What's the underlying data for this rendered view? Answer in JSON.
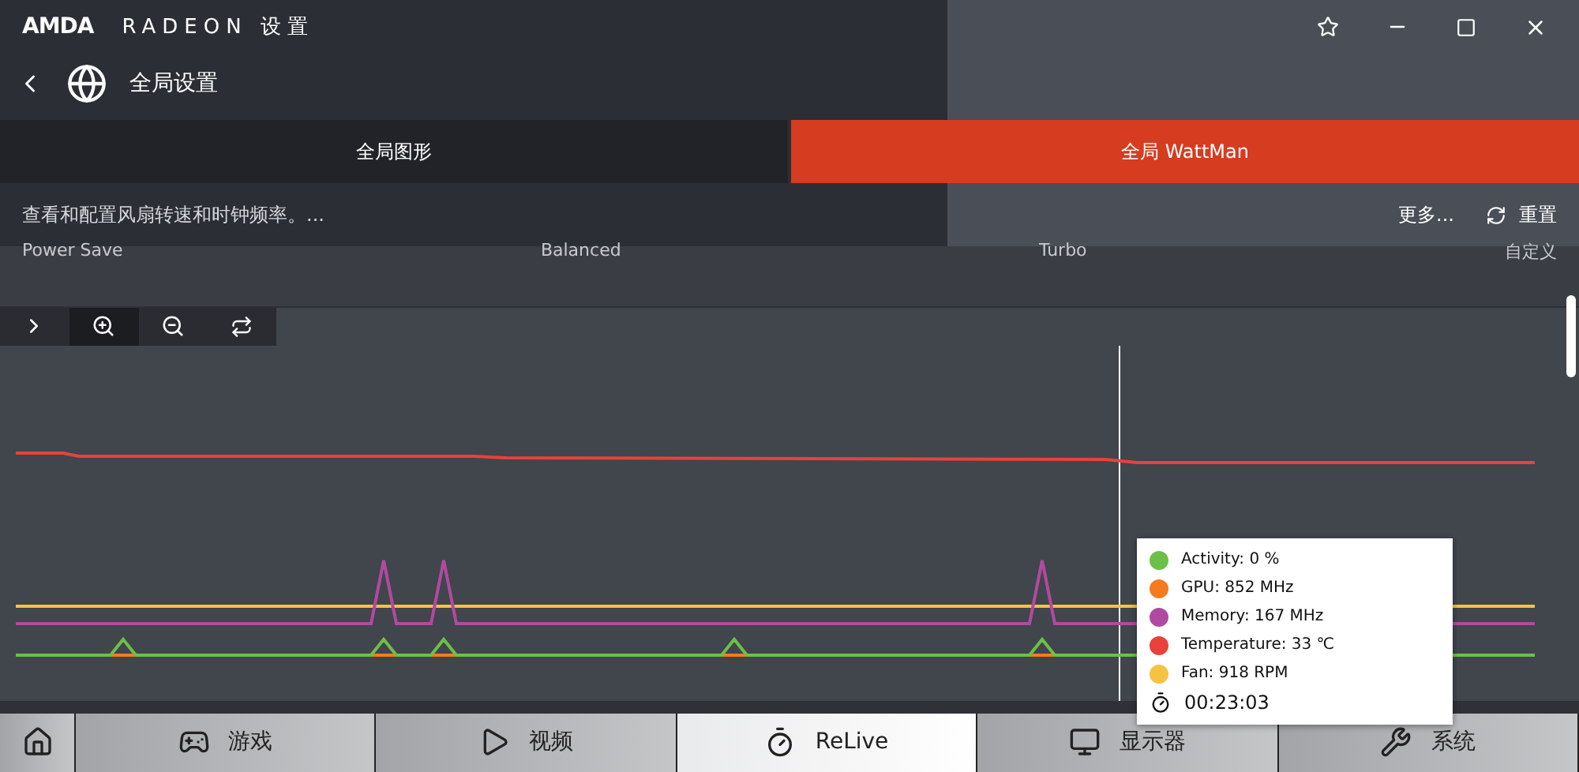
{
  "window": {
    "logo": "AMDA",
    "title": "RADEON 设置"
  },
  "header": {
    "title": "全局设置"
  },
  "tabs": [
    {
      "label": "全局图形",
      "selected": false
    },
    {
      "label": "全局 WattMan",
      "selected": true
    }
  ],
  "description": {
    "text": "查看和配置风扇转速和时钟频率。...",
    "more": "更多...",
    "reset": "重置"
  },
  "profiles": [
    "Power Save",
    "Balanced",
    "Turbo",
    "自定义"
  ],
  "tooltip": {
    "items": [
      {
        "label": "Activity: 0 %",
        "color": "#6cc04a"
      },
      {
        "label": "GPU: 852 MHz",
        "color": "#f47b20"
      },
      {
        "label": "Memory: 167 MHz",
        "color": "#b04aa0"
      },
      {
        "label": "Temperature: 33 ℃",
        "color": "#e8423a"
      },
      {
        "label": "Fan: 918 RPM",
        "color": "#f5c242"
      }
    ],
    "time": "00:23:03"
  },
  "bottom_nav": [
    {
      "kind": "home",
      "selected": false
    },
    {
      "kind": "game",
      "label": "游戏",
      "selected": false
    },
    {
      "kind": "video",
      "label": "视频",
      "selected": false
    },
    {
      "kind": "relive",
      "label": "ReLive",
      "selected": true
    },
    {
      "kind": "display",
      "label": "显示器",
      "selected": false
    },
    {
      "kind": "system",
      "label": "系统",
      "selected": false
    }
  ]
}
